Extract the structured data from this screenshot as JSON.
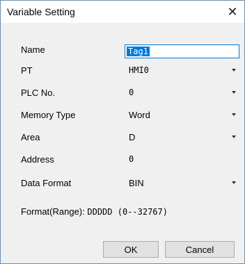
{
  "window": {
    "title": "Variable Setting",
    "close_glyph": "✕"
  },
  "fields": {
    "name": {
      "label": "Name",
      "value": "Tag1"
    },
    "pt": {
      "label": "PT",
      "value": "HMI0"
    },
    "plc_no": {
      "label": "PLC No.",
      "value": "0"
    },
    "memory_type": {
      "label": "Memory Type",
      "value": "Word"
    },
    "area": {
      "label": "Area",
      "value": "D"
    },
    "address": {
      "label": "Address",
      "value": "0"
    },
    "data_format": {
      "label": "Data Format",
      "value": "BIN"
    }
  },
  "format_range": {
    "label": "Format(Range):",
    "value": "DDDDD (0--32767)"
  },
  "buttons": {
    "ok": "OK",
    "cancel": "Cancel"
  },
  "icons": {
    "close": "close-icon",
    "dropdown": "chevron-down-icon"
  }
}
